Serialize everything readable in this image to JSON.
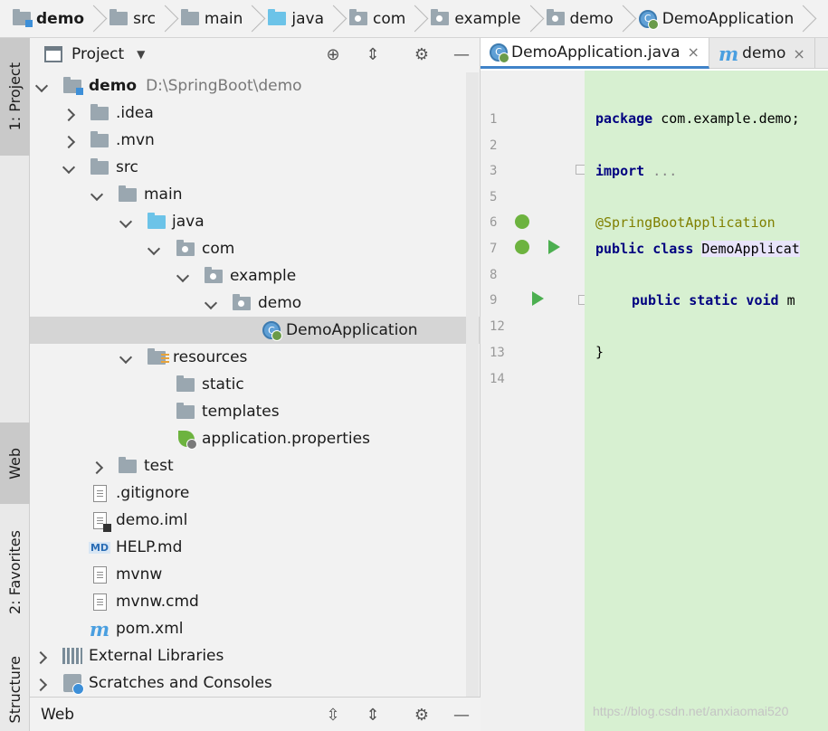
{
  "breadcrumb": [
    "demo",
    "src",
    "main",
    "java",
    "com",
    "example",
    "demo",
    "DemoApplication"
  ],
  "left_strip": {
    "project_tab": "1: Project",
    "web_tab": "Web",
    "favorites_tab": "2: Favorites",
    "structure_tab": "Structure"
  },
  "project_panel": {
    "title": "Project",
    "tree": [
      {
        "label": "demo",
        "path": "D:\\SpringBoot\\demo"
      },
      {
        "label": ".idea"
      },
      {
        "label": ".mvn"
      },
      {
        "label": "src"
      },
      {
        "label": "main"
      },
      {
        "label": "java"
      },
      {
        "label": "com"
      },
      {
        "label": "example"
      },
      {
        "label": "demo"
      },
      {
        "label": "DemoApplication"
      },
      {
        "label": "resources"
      },
      {
        "label": "static"
      },
      {
        "label": "templates"
      },
      {
        "label": "application.properties"
      },
      {
        "label": "test"
      },
      {
        "label": ".gitignore"
      },
      {
        "label": "demo.iml"
      },
      {
        "label": "HELP.md"
      },
      {
        "label": "mvnw"
      },
      {
        "label": "mvnw.cmd"
      },
      {
        "label": "pom.xml"
      },
      {
        "label": "External Libraries"
      },
      {
        "label": "Scratches and Consoles"
      }
    ]
  },
  "bottom_bar": {
    "title": "Web"
  },
  "editor": {
    "tabs": [
      {
        "label": "DemoApplication.java",
        "close": "×"
      },
      {
        "label": "demo",
        "close": "×"
      }
    ],
    "line_numbers": [
      "1",
      "2",
      "3",
      "5",
      "6",
      "7",
      "8",
      "9",
      "12",
      "13",
      "14"
    ],
    "code": {
      "l1_kw": "package",
      "l1_rest": " com.example.demo;",
      "l3_kw": "import",
      "l3_rest": " ...",
      "l6_ann": "@SpringBootApplication",
      "l7_kw": "public class ",
      "l7_rest": "DemoApplicat",
      "l9_kw": "public static void",
      "l9_rest": " m",
      "l13": "}"
    }
  },
  "watermark": "https://blog.csdn.net/anxiaomai520",
  "colors": {
    "code_bg": "#d7f0d1",
    "run_icon": "#4caf50",
    "selection": "#d5d5d5",
    "accent": "#4083c9"
  }
}
